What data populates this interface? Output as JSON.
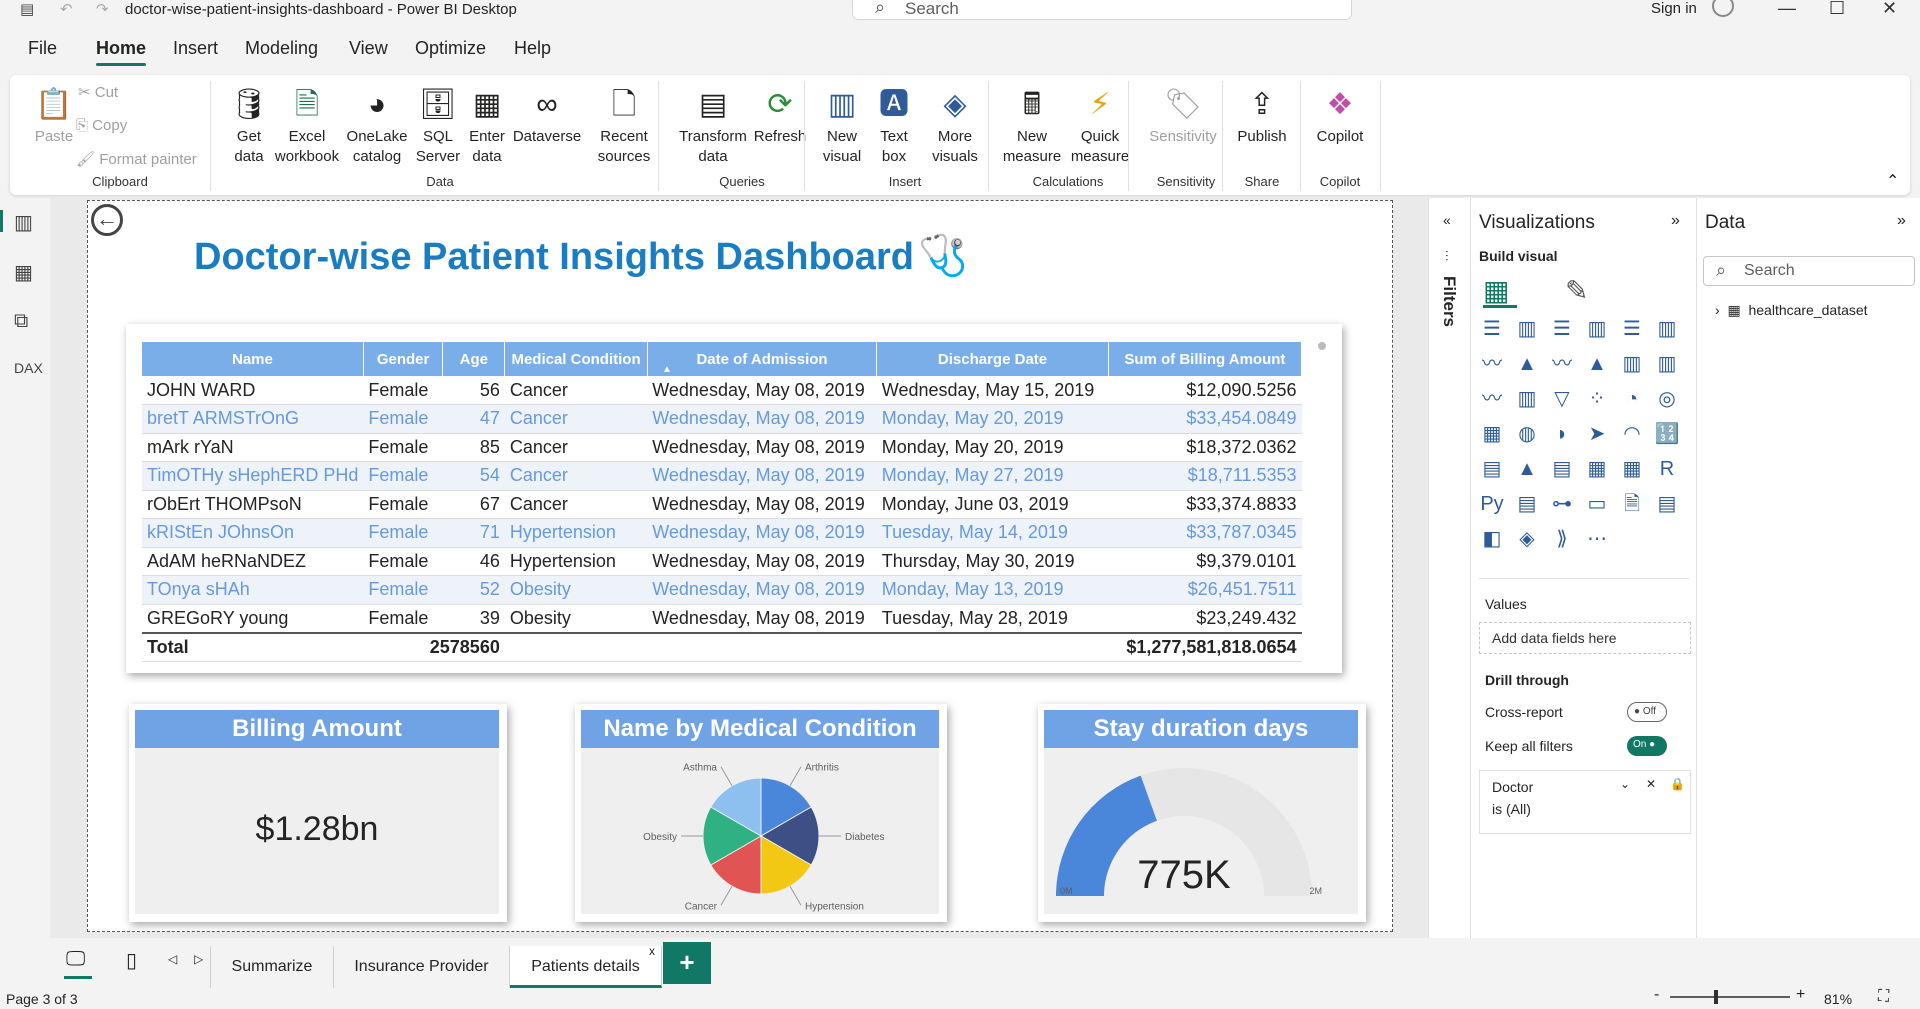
{
  "window": {
    "title": "doctor-wise-patient-insights-dashboard - Power BI Desktop",
    "search_placeholder": "Search",
    "signin": "Sign in"
  },
  "menu": [
    "File",
    "Home",
    "Insert",
    "Modeling",
    "View",
    "Optimize",
    "Help"
  ],
  "ribbon": {
    "clipboard": {
      "paste": "Paste",
      "cut": "Cut",
      "copy": "Copy",
      "format_painter": "Format painter",
      "group": "Clipboard"
    },
    "data": {
      "get_data": "Get data",
      "excel": "Excel workbook",
      "onelake": "OneLake catalog",
      "sql": "SQL Server",
      "enter": "Enter data",
      "dataverse": "Dataverse",
      "recent": "Recent sources",
      "group": "Data"
    },
    "queries": {
      "transform": "Transform data",
      "refresh": "Refresh",
      "group": "Queries"
    },
    "insert": {
      "new_visual": "New visual",
      "text_box": "Text box",
      "more": "More visuals",
      "group": "Insert"
    },
    "calculations": {
      "new_measure": "New measure",
      "quick_measure": "Quick measure",
      "group": "Calculations"
    },
    "sensitivity": {
      "label": "Sensitivity",
      "group": "Sensitivity"
    },
    "share": {
      "publish": "Publish",
      "group": "Share"
    },
    "copilot": {
      "label": "Copilot",
      "group": "Copilot"
    }
  },
  "dashboard": {
    "title": "Doctor-wise Patient Insights Dashboard",
    "table": {
      "columns": [
        "Name",
        "Gender",
        "Age",
        "Medical Condition",
        "Date of Admission",
        "Discharge Date",
        "Sum of Billing Amount"
      ],
      "rows": [
        [
          "JOHN WARD",
          "Female",
          "56",
          "Cancer",
          "Wednesday, May 08, 2019",
          "Wednesday, May 15, 2019",
          "$12,090.5256"
        ],
        [
          "bretT ARMSTrOnG",
          "Female",
          "47",
          "Cancer",
          "Wednesday, May 08, 2019",
          "Monday, May 20, 2019",
          "$33,454.0849"
        ],
        [
          "mArk rYaN",
          "Female",
          "85",
          "Cancer",
          "Wednesday, May 08, 2019",
          "Monday, May 20, 2019",
          "$18,372.0362"
        ],
        [
          "TimOTHy sHephERD PHd",
          "Female",
          "54",
          "Cancer",
          "Wednesday, May 08, 2019",
          "Monday, May 27, 2019",
          "$18,711.5353"
        ],
        [
          "rObErt THOMPsoN",
          "Female",
          "67",
          "Cancer",
          "Wednesday, May 08, 2019",
          "Monday, June 03, 2019",
          "$33,374.8833"
        ],
        [
          "kRIStEn JOhnsOn",
          "Female",
          "71",
          "Hypertension",
          "Wednesday, May 08, 2019",
          "Tuesday, May 14, 2019",
          "$33,787.0345"
        ],
        [
          "AdAM heRNaNDEZ",
          "Female",
          "46",
          "Hypertension",
          "Wednesday, May 08, 2019",
          "Thursday, May 30, 2019",
          "$9,379.0101"
        ],
        [
          "TOnya sHAh",
          "Female",
          "52",
          "Obesity",
          "Wednesday, May 08, 2019",
          "Monday, May 13, 2019",
          "$26,451.7511"
        ],
        [
          "GREGoRY young",
          "Female",
          "39",
          "Obesity",
          "Wednesday, May 08, 2019",
          "Tuesday, May 28, 2019",
          "$23,249.432"
        ]
      ],
      "total_label": "Total",
      "total_age": "2578560",
      "total_billing": "$1,277,581,818.0654"
    },
    "billing_card": {
      "title": "Billing Amount",
      "value": "$1.28bn"
    },
    "pie_card": {
      "title": "Name by Medical Condition",
      "slices": [
        {
          "label": "Arthritis",
          "color": "#4a86d9"
        },
        {
          "label": "Diabetes",
          "color": "#3e4f86"
        },
        {
          "label": "Hypertension",
          "color": "#f2c814"
        },
        {
          "label": "Cancer",
          "color": "#e05454"
        },
        {
          "label": "Obesity",
          "color": "#2fb183"
        },
        {
          "label": "Asthma",
          "color": "#8ec0ef"
        }
      ]
    },
    "gauge_card": {
      "title": "Stay duration days",
      "value": "775K",
      "min": "0M",
      "max": "2M",
      "fraction": 0.39
    }
  },
  "chart_data": {
    "type": "pie",
    "title": "Name by Medical Condition",
    "categories": [
      "Arthritis",
      "Diabetes",
      "Hypertension",
      "Cancer",
      "Obesity",
      "Asthma"
    ],
    "values": [
      1,
      1,
      1,
      1,
      1,
      1
    ]
  },
  "panes": {
    "filters_label": "Filters",
    "visualizations": "Visualizations",
    "build_visual": "Build visual",
    "values": "Values",
    "add_fields": "Add data fields here",
    "drill_through": "Drill through",
    "cross_report": "Cross-report",
    "cross_report_state": "Off",
    "keep_filters": "Keep all filters",
    "keep_filters_state": "On",
    "filter_field": "Doctor",
    "filter_value": "is (All)",
    "data": "Data",
    "data_search": "Search",
    "dataset": "healthcare_dataset"
  },
  "pages": [
    "Summarize",
    "Insurance Provider",
    "Patients details"
  ],
  "status": {
    "page": "Page 3 of 3",
    "zoom": "81%"
  }
}
